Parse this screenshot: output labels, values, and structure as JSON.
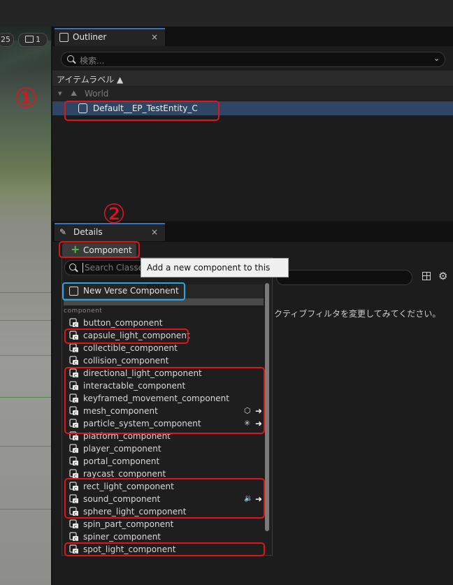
{
  "viewport": {
    "badge_speed": "25",
    "badge_camera": "1"
  },
  "outliner": {
    "tab_label": "Outliner",
    "close_glyph": "×",
    "search_placeholder": "検索...",
    "column_header": "アイテムラベル ▲",
    "world_label": "World",
    "entity_label": "Default__EP_TestEntity_C"
  },
  "details": {
    "tab_label": "Details",
    "close_glyph": "×",
    "add_component_label": "Component",
    "search_placeholder": "Search Classes",
    "tooltip": "Add a new component to this entity.",
    "filter_hint": "クティブフィルタを変更してみてください。",
    "new_verse_label": "New Verse Component",
    "section_label": "component",
    "items": [
      {
        "label": "button_component"
      },
      {
        "label": "capsule_light_component"
      },
      {
        "label": "collectible_component"
      },
      {
        "label": "collision_component"
      },
      {
        "label": "directional_light_component"
      },
      {
        "label": "interactable_component"
      },
      {
        "label": "keyframed_movement_component"
      },
      {
        "label": "mesh_component"
      },
      {
        "label": "particle_system_component"
      },
      {
        "label": "platform_component"
      },
      {
        "label": "player_component"
      },
      {
        "label": "portal_component"
      },
      {
        "label": "raycast_component"
      },
      {
        "label": "rect_light_component"
      },
      {
        "label": "sound_component"
      },
      {
        "label": "sphere_light_component"
      },
      {
        "label": "spin_part_component"
      },
      {
        "label": "spiner_component"
      },
      {
        "label": "spot_light_component"
      }
    ]
  },
  "annotations": {
    "step1": "①",
    "step2": "②"
  },
  "colors": {
    "annotation_red": "#e0141c",
    "annotation_blue": "#2aa7e3",
    "tab_accent": "#3d6fbf",
    "selection": "#2e4564"
  }
}
